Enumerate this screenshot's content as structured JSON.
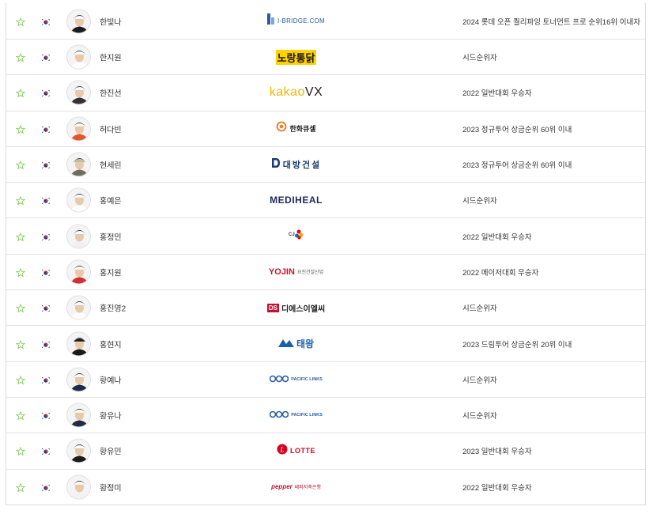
{
  "colors": {
    "star": "#8fd16b",
    "border": "#e3e3e3"
  },
  "rows": [
    {
      "name": "한빛나",
      "sponsor": "I-BRIDGE.COM",
      "sponsor_icon": "ibridge-logo",
      "qualification": "2024 롯데 오픈 퀄리파잉 토너먼트 프로 순위16위 이내자",
      "hat": "#ffffff",
      "shirt": "#1c1c1c"
    },
    {
      "name": "한지원",
      "sponsor": "노랑통닭",
      "sponsor_icon": "norang-logo",
      "qualification": "시드순위자",
      "hat": "#ffffff",
      "shirt": "#ffffff"
    },
    {
      "name": "한진선",
      "sponsor": "kakaoVX",
      "sponsor_sub": "VX",
      "sponsor_icon": "kakaovx-logo",
      "qualification": "2022 일반대회 우승자",
      "hat": "#ffffff",
      "shirt": "#333333"
    },
    {
      "name": "허다빈",
      "sponsor": "한화큐셀",
      "sponsor_icon": "hanwha-logo",
      "qualification": "2023 정규투어 상금순위 60위 이내",
      "hat": "#ffffff",
      "shirt": "#e2572e"
    },
    {
      "name": "현세린",
      "sponsor": "대방건설",
      "sponsor_icon": "daebang-logo",
      "qualification": "2023 정규투어 상금순위 60위 이내",
      "hat": "#c9b99a",
      "shirt": "#6e6e5a"
    },
    {
      "name": "홍예은",
      "sponsor": "MEDIHEAL",
      "sponsor_icon": "mediheal-logo",
      "qualification": "시드순위자",
      "hat": "#ffffff",
      "shirt": "#ffffff"
    },
    {
      "name": "홍정민",
      "sponsor": "CJ",
      "sponsor_icon": "cj-logo",
      "qualification": "2022 일반대회 우승자",
      "hat": "#ffffff",
      "shirt": "#f0f0f0"
    },
    {
      "name": "홍지원",
      "sponsor": "YOJIN",
      "sponsor_sub": "요진건설산업",
      "sponsor_icon": "yojin-logo",
      "qualification": "2022 메이저대회 우승자",
      "hat": "#ffffff",
      "shirt": "#d32f2f"
    },
    {
      "name": "홍진영2",
      "sponsor": "디에스이엘씨",
      "sponsor_sub": "DS",
      "sponsor_icon": "ds-logo",
      "qualification": "시드순위자",
      "hat": "#ffffff",
      "shirt": "#ffffff"
    },
    {
      "name": "홍현지",
      "sponsor": "태왕",
      "sponsor_icon": "taewang-logo",
      "qualification": "2023 드림투어 상금순위 20위 이내",
      "hat": "#1a1a1a",
      "shirt": "#1a1a1a"
    },
    {
      "name": "황예나",
      "sponsor": "PACIFIC LINKS",
      "sponsor_icon": "pacificlinks-logo",
      "qualification": "시드순위자",
      "hat": "#ffffff",
      "shirt": "#1f2a44"
    },
    {
      "name": "황유나",
      "sponsor": "PACIFIC LINKS",
      "sponsor_icon": "pacificlinks-logo",
      "qualification": "시드순위자",
      "hat": "#ffffff",
      "shirt": "#1f2a44"
    },
    {
      "name": "황유민",
      "sponsor": "LOTTE",
      "sponsor_icon": "lotte-logo",
      "qualification": "2023 일반대회 우승자",
      "hat": "#ffffff",
      "shirt": "#1a1a1a"
    },
    {
      "name": "황정미",
      "sponsor": "pepper",
      "sponsor_sub": "페퍼저축은행",
      "sponsor_icon": "pepper-logo",
      "qualification": "2022 일반대회 우승자",
      "hat": "#ffffff",
      "shirt": "#f2f2f2"
    }
  ]
}
